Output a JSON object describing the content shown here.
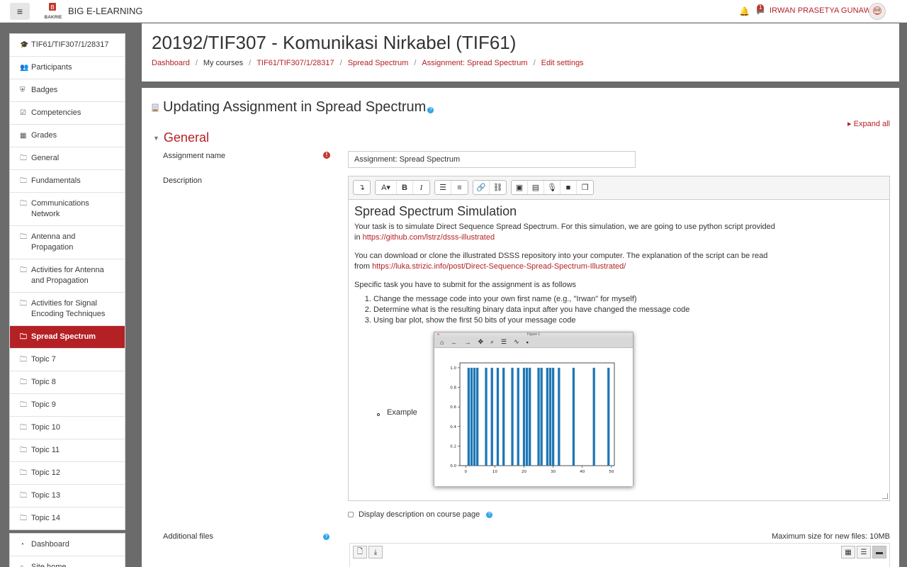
{
  "navbar": {
    "site_name": "BIG E-LEARNING",
    "logo_text": "BAKRIE",
    "notification_count": "1",
    "username": "IRWAN PRASETYA GUNAWAN"
  },
  "sidebar": {
    "course_items": [
      {
        "icon": "graduation-cap-icon",
        "glyph": "🎓",
        "label": "TIF61/TIF307/1/28317"
      },
      {
        "icon": "users-icon",
        "glyph": "👥",
        "label": "Participants"
      },
      {
        "icon": "shield-icon",
        "glyph": "⛨",
        "label": "Badges"
      },
      {
        "icon": "checkbox-icon",
        "glyph": "☑",
        "label": "Competencies"
      },
      {
        "icon": "table-icon",
        "glyph": "▦",
        "label": "Grades"
      },
      {
        "icon": "folder-icon",
        "glyph": "🗀",
        "label": "General"
      },
      {
        "icon": "folder-icon",
        "glyph": "🗀",
        "label": "Fundamentals"
      },
      {
        "icon": "folder-icon",
        "glyph": "🗀",
        "label": "Communications Network"
      },
      {
        "icon": "folder-icon",
        "glyph": "🗀",
        "label": "Antenna and Propagation"
      },
      {
        "icon": "folder-icon",
        "glyph": "🗀",
        "label": "Activities for Antenna and Propagation"
      },
      {
        "icon": "folder-icon",
        "glyph": "🗀",
        "label": "Activities for Signal Encoding Techniques"
      },
      {
        "icon": "folder-icon",
        "glyph": "🗀",
        "label": "Spread Spectrum",
        "active": true
      },
      {
        "icon": "folder-icon",
        "glyph": "🗀",
        "label": "Topic 7"
      },
      {
        "icon": "folder-icon",
        "glyph": "🗀",
        "label": "Topic 8"
      },
      {
        "icon": "folder-icon",
        "glyph": "🗀",
        "label": "Topic 9"
      },
      {
        "icon": "folder-icon",
        "glyph": "🗀",
        "label": "Topic 10"
      },
      {
        "icon": "folder-icon",
        "glyph": "🗀",
        "label": "Topic 11"
      },
      {
        "icon": "folder-icon",
        "glyph": "🗀",
        "label": "Topic 12"
      },
      {
        "icon": "folder-icon",
        "glyph": "🗀",
        "label": "Topic 13"
      },
      {
        "icon": "folder-icon",
        "glyph": "🗀",
        "label": "Topic 14"
      }
    ],
    "site_items": [
      {
        "icon": "dashboard-icon",
        "glyph": "◔",
        "label": "Dashboard"
      },
      {
        "icon": "home-icon",
        "glyph": "⌂",
        "label": "Site home"
      }
    ]
  },
  "header": {
    "course_title": "20192/TIF307 - Komunikasi Nirkabel (TIF61)",
    "breadcrumb": [
      {
        "label": "Dashboard",
        "link": true
      },
      {
        "label": "My courses",
        "link": false
      },
      {
        "label": "TIF61/TIF307/1/28317",
        "link": true
      },
      {
        "label": "Spread Spectrum",
        "link": true
      },
      {
        "label": "Assignment: Spread Spectrum",
        "link": true
      },
      {
        "label": "Edit settings",
        "link": true
      }
    ]
  },
  "main": {
    "page_title": "Updating Assignment in Spread Spectrum",
    "expand_all": "Expand all",
    "section_general": "General",
    "assignment_name_label": "Assignment name",
    "assignment_name_value": "Assignment: Spread Spectrum",
    "description_label": "Description",
    "editor": {
      "heading": "Spread Spectrum Simulation",
      "p1": "Your task is to simulate Direct Sequence Spread Spectrum. For this simulation, we are going to use python script provided in ",
      "p1_link": "https://github.com/lstrz/dsss-illustrated",
      "p2": "You can download or clone the illustrated DSSS repository into your computer. The explanation of the script can be read from ",
      "p2_link": "https://luka.strizic.info/post/Direct-Sequence-Spread-Spectrum-Illustrated/",
      "p3": "Specific task you have to submit for the assignment is as follows",
      "list": [
        "Change the message code into your own first name (e.g., \"Irwan\" for myself)",
        "Determine what is the resulting binary data input after you have changed the message code",
        "Using bar plot, show the first 50 bits of your message code"
      ],
      "example_label": "Example",
      "figure_title": "Figure 1"
    },
    "display_desc_label": "Display description on course page",
    "additional_files_label": "Additional files",
    "max_size": "Maximum size for new files: 10MB"
  },
  "chart_data": {
    "type": "bar",
    "x": [
      1,
      2,
      3,
      4,
      7,
      9,
      11,
      13,
      16,
      18,
      20,
      21,
      22,
      25,
      26,
      28,
      29,
      30,
      32,
      37,
      44,
      49
    ],
    "values": [
      1,
      1,
      1,
      1,
      1,
      1,
      1,
      1,
      1,
      1,
      1,
      1,
      1,
      1,
      1,
      1,
      1,
      1,
      1,
      1,
      1,
      1
    ],
    "xlim": [
      -2,
      51
    ],
    "ylim": [
      0,
      1.05
    ],
    "xticks": [
      "0",
      "10",
      "20",
      "30",
      "40",
      "50"
    ],
    "yticks": [
      "0.0",
      "0.2",
      "0.4",
      "0.6",
      "0.8",
      "1.0"
    ],
    "color": "#1f77b4"
  }
}
